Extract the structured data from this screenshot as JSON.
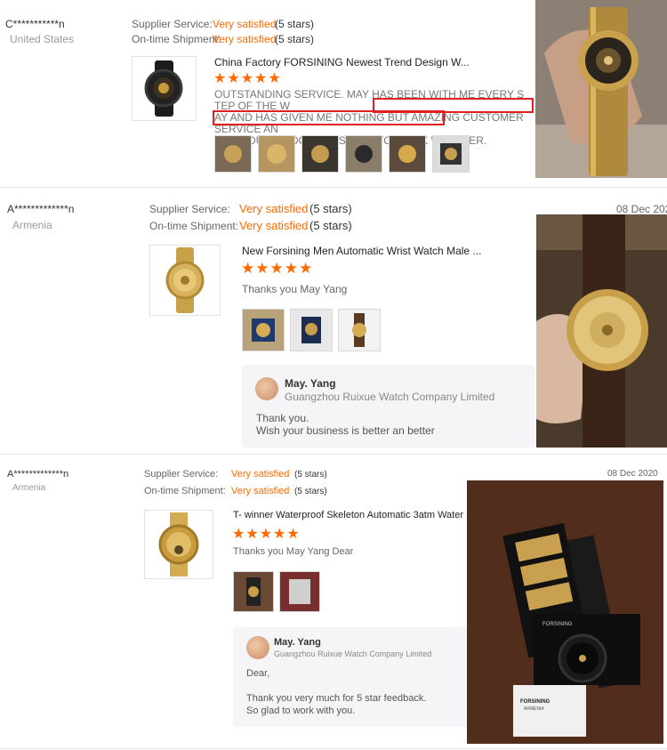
{
  "reviews": [
    {
      "reviewer": "C***********n",
      "country": "United States",
      "date": "",
      "ratings": [
        {
          "label": "Supplier Service:",
          "value": "Very satisfied",
          "stars": "(5 stars)"
        },
        {
          "label": "On-time Shipment:",
          "value": "Very satisfied",
          "stars": "(5 stars)"
        }
      ],
      "product_title": "China Factory FORSINING Newest Trend Design W...",
      "star_rating": "★★★★★",
      "text_line1": "OUTSTANDING SERVICE. MAY HAS BEEN WITH ME EVERY STEP OF THE W",
      "text_line2": "AY AND HAS GIVEN ME NOTHING BUT AMAZING CUSTOMER SERVICE AN",
      "text_line3": "D PRODUCTS. DONT HESITATE TO WORK WITH HER.",
      "thumbnail_count": 6
    },
    {
      "reviewer": "A*************n",
      "country": "Armenia",
      "date": "08 Dec 2020",
      "ratings": [
        {
          "label": "Supplier Service:",
          "value": "Very satisfied",
          "stars": "(5 stars)"
        },
        {
          "label": "On-time Shipment:",
          "value": "Very satisfied",
          "stars": "(5 stars)"
        }
      ],
      "product_title": "New Forsining Men Automatic Wrist Watch Male ...",
      "star_rating": "★★★★★",
      "text": "Thanks you May Yang",
      "thumbnail_count": 3,
      "reply": {
        "name": "May. Yang",
        "company": "Guangzhou Ruixue Watch Company Limited",
        "line1": "Thank you.",
        "line2": "Wish your business is better an better"
      }
    },
    {
      "reviewer": "A*************n",
      "country": "Armenia",
      "date": "08 Dec 2020",
      "ratings": [
        {
          "label": "Supplier Service:",
          "value": "Very satisfied",
          "stars": "(5 stars)"
        },
        {
          "label": "On-time Shipment:",
          "value": "Very satisfied",
          "stars": "(5 stars)"
        }
      ],
      "product_title": "T- winner Waterproof Skeleton Automatic 3atm Water ...",
      "star_rating": "★★★★★",
      "text": "Thanks you May Yang Dear",
      "thumbnail_count": 2,
      "reply": {
        "name": "May. Yang",
        "company": "Guangzhou Ruixue Watch Company Limited",
        "line1": "Dear,",
        "line2": "Thank you very much for 5 star feedback.",
        "line3": "So glad to work with you."
      }
    }
  ],
  "photo_labels": {
    "box_brand": "FORSINING",
    "box_sub": "ARMENIA"
  },
  "colors": {
    "accent": "#ff6a00",
    "highlight_box": "#e02020"
  }
}
